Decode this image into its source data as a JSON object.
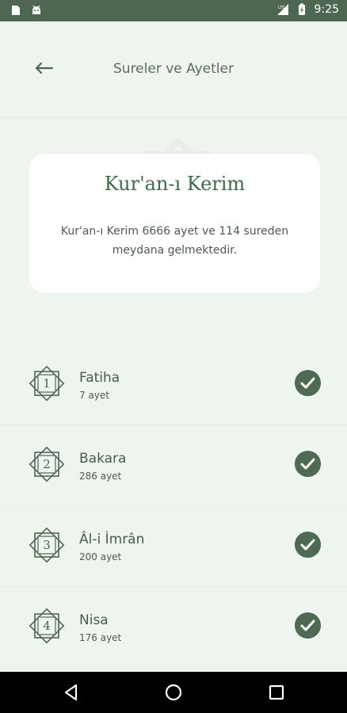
{
  "status_bar": {
    "time": "9:25",
    "network": "LTE",
    "icons": [
      "notification-icon",
      "android-icon",
      "signal-icon",
      "battery-icon"
    ]
  },
  "header": {
    "title": "Sureler ve Ayetler",
    "back_icon": "arrow-left-icon"
  },
  "hero": {
    "title": "Kur'an-ı Kerim",
    "description": "Kur'an-ı Kerim 6666 ayet ve 114 sureden meydana gelmektedir."
  },
  "surahs": [
    {
      "number": "1",
      "name": "Fatiha",
      "ayet": "7 ayet",
      "completed": true
    },
    {
      "number": "2",
      "name": "Bakara",
      "ayet": "286 ayet",
      "completed": true
    },
    {
      "number": "3",
      "name": "Âl-i İmrân",
      "ayet": "200 ayet",
      "completed": true
    },
    {
      "number": "4",
      "name": "Nisa",
      "ayet": "176 ayet",
      "completed": true
    }
  ],
  "nav": [
    "back-triangle-icon",
    "home-circle-icon",
    "recents-square-icon"
  ],
  "colors": {
    "primary": "#4e6752",
    "background": "#eef5ef",
    "card": "#ffffff",
    "accent_text": "#3f6a4a"
  }
}
